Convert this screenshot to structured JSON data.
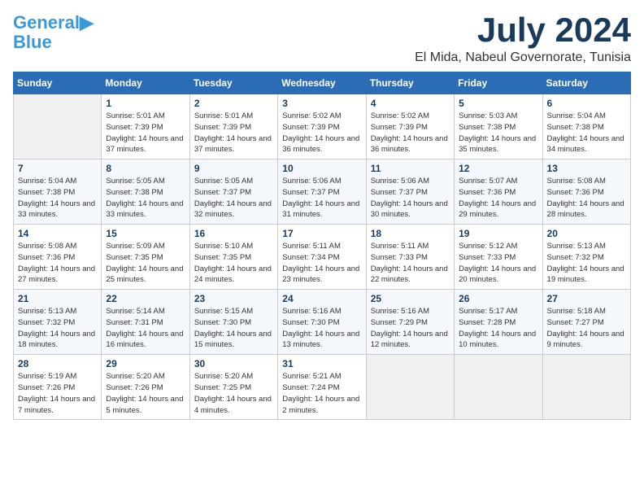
{
  "header": {
    "logo_line1": "General",
    "logo_line2": "Blue",
    "month_year": "July 2024",
    "location": "El Mida, Nabeul Governorate, Tunisia"
  },
  "weekdays": [
    "Sunday",
    "Monday",
    "Tuesday",
    "Wednesday",
    "Thursday",
    "Friday",
    "Saturday"
  ],
  "weeks": [
    [
      {
        "day": "",
        "empty": true
      },
      {
        "day": "1",
        "sunrise": "5:01 AM",
        "sunset": "7:39 PM",
        "daylight": "14 hours and 37 minutes."
      },
      {
        "day": "2",
        "sunrise": "5:01 AM",
        "sunset": "7:39 PM",
        "daylight": "14 hours and 37 minutes."
      },
      {
        "day": "3",
        "sunrise": "5:02 AM",
        "sunset": "7:39 PM",
        "daylight": "14 hours and 36 minutes."
      },
      {
        "day": "4",
        "sunrise": "5:02 AM",
        "sunset": "7:39 PM",
        "daylight": "14 hours and 36 minutes."
      },
      {
        "day": "5",
        "sunrise": "5:03 AM",
        "sunset": "7:38 PM",
        "daylight": "14 hours and 35 minutes."
      },
      {
        "day": "6",
        "sunrise": "5:04 AM",
        "sunset": "7:38 PM",
        "daylight": "14 hours and 34 minutes."
      }
    ],
    [
      {
        "day": "7",
        "sunrise": "5:04 AM",
        "sunset": "7:38 PM",
        "daylight": "14 hours and 33 minutes."
      },
      {
        "day": "8",
        "sunrise": "5:05 AM",
        "sunset": "7:38 PM",
        "daylight": "14 hours and 33 minutes."
      },
      {
        "day": "9",
        "sunrise": "5:05 AM",
        "sunset": "7:37 PM",
        "daylight": "14 hours and 32 minutes."
      },
      {
        "day": "10",
        "sunrise": "5:06 AM",
        "sunset": "7:37 PM",
        "daylight": "14 hours and 31 minutes."
      },
      {
        "day": "11",
        "sunrise": "5:06 AM",
        "sunset": "7:37 PM",
        "daylight": "14 hours and 30 minutes."
      },
      {
        "day": "12",
        "sunrise": "5:07 AM",
        "sunset": "7:36 PM",
        "daylight": "14 hours and 29 minutes."
      },
      {
        "day": "13",
        "sunrise": "5:08 AM",
        "sunset": "7:36 PM",
        "daylight": "14 hours and 28 minutes."
      }
    ],
    [
      {
        "day": "14",
        "sunrise": "5:08 AM",
        "sunset": "7:36 PM",
        "daylight": "14 hours and 27 minutes."
      },
      {
        "day": "15",
        "sunrise": "5:09 AM",
        "sunset": "7:35 PM",
        "daylight": "14 hours and 25 minutes."
      },
      {
        "day": "16",
        "sunrise": "5:10 AM",
        "sunset": "7:35 PM",
        "daylight": "14 hours and 24 minutes."
      },
      {
        "day": "17",
        "sunrise": "5:11 AM",
        "sunset": "7:34 PM",
        "daylight": "14 hours and 23 minutes."
      },
      {
        "day": "18",
        "sunrise": "5:11 AM",
        "sunset": "7:33 PM",
        "daylight": "14 hours and 22 minutes."
      },
      {
        "day": "19",
        "sunrise": "5:12 AM",
        "sunset": "7:33 PM",
        "daylight": "14 hours and 20 minutes."
      },
      {
        "day": "20",
        "sunrise": "5:13 AM",
        "sunset": "7:32 PM",
        "daylight": "14 hours and 19 minutes."
      }
    ],
    [
      {
        "day": "21",
        "sunrise": "5:13 AM",
        "sunset": "7:32 PM",
        "daylight": "14 hours and 18 minutes."
      },
      {
        "day": "22",
        "sunrise": "5:14 AM",
        "sunset": "7:31 PM",
        "daylight": "14 hours and 16 minutes."
      },
      {
        "day": "23",
        "sunrise": "5:15 AM",
        "sunset": "7:30 PM",
        "daylight": "14 hours and 15 minutes."
      },
      {
        "day": "24",
        "sunrise": "5:16 AM",
        "sunset": "7:30 PM",
        "daylight": "14 hours and 13 minutes."
      },
      {
        "day": "25",
        "sunrise": "5:16 AM",
        "sunset": "7:29 PM",
        "daylight": "14 hours and 12 minutes."
      },
      {
        "day": "26",
        "sunrise": "5:17 AM",
        "sunset": "7:28 PM",
        "daylight": "14 hours and 10 minutes."
      },
      {
        "day": "27",
        "sunrise": "5:18 AM",
        "sunset": "7:27 PM",
        "daylight": "14 hours and 9 minutes."
      }
    ],
    [
      {
        "day": "28",
        "sunrise": "5:19 AM",
        "sunset": "7:26 PM",
        "daylight": "14 hours and 7 minutes."
      },
      {
        "day": "29",
        "sunrise": "5:20 AM",
        "sunset": "7:26 PM",
        "daylight": "14 hours and 5 minutes."
      },
      {
        "day": "30",
        "sunrise": "5:20 AM",
        "sunset": "7:25 PM",
        "daylight": "14 hours and 4 minutes."
      },
      {
        "day": "31",
        "sunrise": "5:21 AM",
        "sunset": "7:24 PM",
        "daylight": "14 hours and 2 minutes."
      },
      {
        "day": "",
        "empty": true
      },
      {
        "day": "",
        "empty": true
      },
      {
        "day": "",
        "empty": true
      }
    ]
  ]
}
